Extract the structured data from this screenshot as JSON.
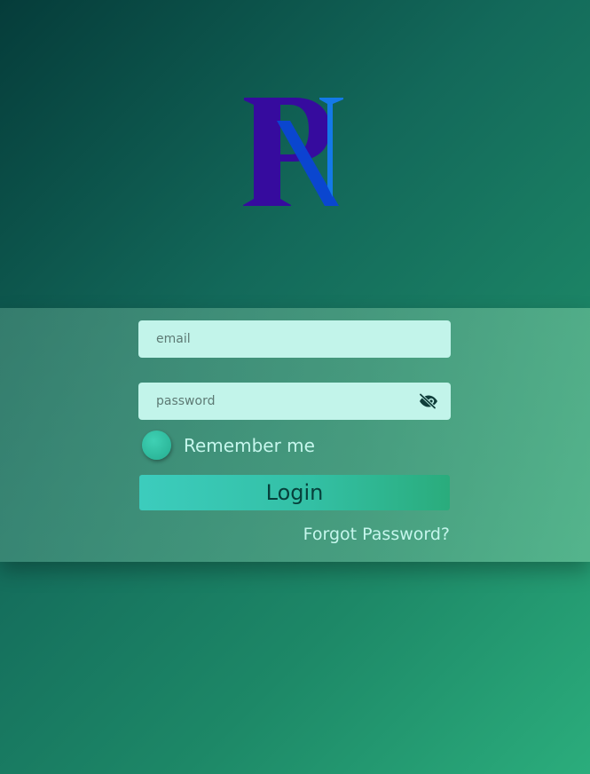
{
  "logo": {
    "letters": "PN",
    "colors": [
      "#350aa0",
      "#0b44d2",
      "#1277e6"
    ]
  },
  "form": {
    "email_placeholder": "email",
    "password_placeholder": "password",
    "password_visibility_icon": "eye-slash-icon",
    "remember_label": "Remember me",
    "login_label": "Login",
    "forgot_label": "Forgot Password?"
  }
}
